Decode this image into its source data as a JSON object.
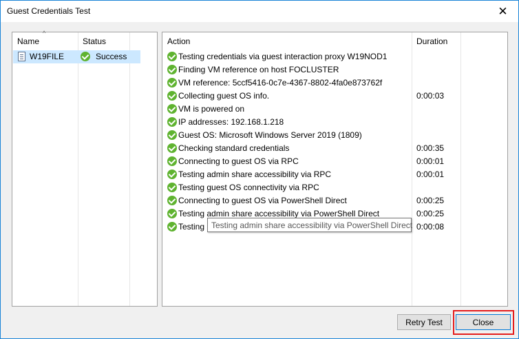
{
  "window": {
    "title": "Guest Credentials Test",
    "close_glyph": "✕"
  },
  "vm_list": {
    "columns": {
      "name": "Name",
      "status": "Status"
    },
    "rows": [
      {
        "name": "W19FILE",
        "status": "Success",
        "icon": "document-icon",
        "status_icon": "success-check-icon"
      }
    ]
  },
  "log": {
    "columns": {
      "action": "Action",
      "duration": "Duration"
    },
    "rows": [
      {
        "action": "Testing credentials via guest interaction proxy W19NOD1",
        "duration": ""
      },
      {
        "action": "Finding VM reference on host FOCLUSTER",
        "duration": ""
      },
      {
        "action": "VM reference: 5ccf5416-0c7e-4367-8802-4fa0e873762f",
        "duration": ""
      },
      {
        "action": "Collecting guest OS info.",
        "duration": "0:00:03"
      },
      {
        "action": "VM is powered on",
        "duration": ""
      },
      {
        "action": "IP addresses: 192.168.1.218",
        "duration": ""
      },
      {
        "action": "Guest OS: Microsoft Windows Server 2019 (1809)",
        "duration": ""
      },
      {
        "action": "Checking standard credentials",
        "duration": "0:00:35"
      },
      {
        "action": "Connecting to guest OS via RPC",
        "duration": "0:00:01"
      },
      {
        "action": "Testing admin share accessibility via RPC",
        "duration": "0:00:01"
      },
      {
        "action": "Testing guest OS connectivity via RPC",
        "duration": ""
      },
      {
        "action": "Connecting to guest OS via PowerShell Direct",
        "duration": "0:00:25"
      },
      {
        "action": "Testing admin share accessibility via PowerShell Direct",
        "duration": "0:00:25"
      },
      {
        "action": "Testing",
        "duration": "0:00:08"
      }
    ]
  },
  "tooltip": {
    "text": "Testing admin share accessibility via PowerShell Direct"
  },
  "buttons": {
    "retry_label": "Retry Test",
    "close_label": "Close"
  },
  "colors": {
    "success": "#5fb330",
    "selection": "#cce8ff",
    "highlight": "#e41c1c"
  }
}
